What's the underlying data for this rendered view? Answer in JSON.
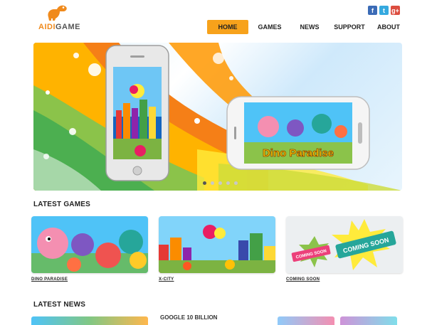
{
  "brand": {
    "name_accent": "AIDI",
    "name_rest": "GAME"
  },
  "social": [
    {
      "icon": "facebook-icon",
      "glyph": "f"
    },
    {
      "icon": "twitter-icon",
      "glyph": "t"
    },
    {
      "icon": "google-plus-icon",
      "glyph": "g+"
    }
  ],
  "nav": [
    "HOME",
    "GAMES",
    "NEWS",
    "SUPPORT",
    "ABOUT"
  ],
  "nav_active": "HOME",
  "hero": {
    "phone2_game_title": "Dino Paradise",
    "slides": 5,
    "active_slide": 0
  },
  "latest_games": {
    "title": "LATEST GAMES",
    "items": [
      {
        "label": "DINO PARADISE"
      },
      {
        "label": "X-CITY"
      },
      {
        "label": "COMING SOON",
        "badges": [
          "COMING SOON",
          "COMING SOON"
        ]
      }
    ]
  },
  "latest_news": {
    "title": "LATEST NEWS",
    "headline": "GOOGLE 10 BILLION"
  },
  "colors": {
    "accent": "#f7a21b",
    "brand_orange": "#f08a1c"
  }
}
